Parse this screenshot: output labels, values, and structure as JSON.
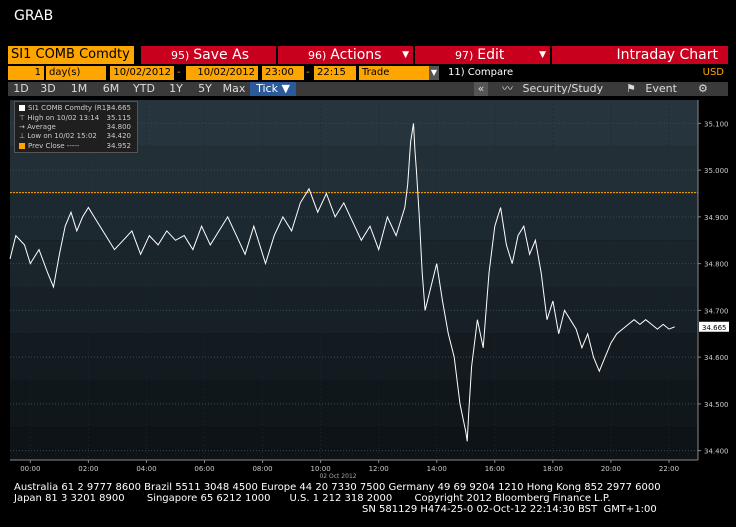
{
  "app": {
    "grab_label": "GRAB"
  },
  "header": {
    "ticker": "SI1 COMB Comdty",
    "save_as": {
      "num": "95)",
      "label": "Save As"
    },
    "actions": {
      "num": "96)",
      "label": "Actions"
    },
    "edit": {
      "num": "97)",
      "label": "Edit"
    },
    "chart_type": "Intraday Chart"
  },
  "controls": {
    "period_count": "1",
    "period_unit": "day(s)",
    "start_date": "10/02/2012",
    "end_date": "10/02/2012",
    "start_time": "23:00",
    "end_time": "22:15",
    "field": "Trade",
    "compare": "11) Compare",
    "currency": "USD"
  },
  "toolbar": {
    "buttons": [
      "1D",
      "3D",
      "1M",
      "6M",
      "YTD",
      "1Y",
      "5Y",
      "Max"
    ],
    "tick": "Tick ▼",
    "collapse": "«",
    "security_study": "Security/Study",
    "event": "Event",
    "gear": "⚙"
  },
  "legend": {
    "rows": [
      {
        "label": "SI1 COMB Comdty (R1)",
        "value": "34.665"
      },
      {
        "label": "High on 10/02 13:14",
        "value": "35.115"
      },
      {
        "label": "Average",
        "value": "34.800"
      },
      {
        "label": "Low on 10/02 15:02",
        "value": "34.420"
      },
      {
        "label": "Prev Close -----",
        "value": "34.952"
      }
    ]
  },
  "chart_data": {
    "type": "line",
    "x_ticks": [
      "00:00",
      "02:00",
      "04:00",
      "06:00",
      "08:00",
      "10:00",
      "12:00",
      "14:00",
      "16:00",
      "18:00",
      "20:00",
      "22:00"
    ],
    "x_date_label": "02 Oct 2012",
    "y_ticks": [
      "35.100",
      "35.000",
      "34.900",
      "34.800",
      "34.700",
      "34.600",
      "34.500",
      "34.400"
    ],
    "ylim": [
      34.38,
      35.15
    ],
    "xlim": [
      -0.7,
      23.0
    ],
    "prev_close": 34.952,
    "last_value": "34.665",
    "colors": {
      "line": "#ffffff",
      "prev_close": "#ffa500",
      "last_label_bg": "#ffffff"
    },
    "series": [
      {
        "x": [
          -0.7,
          -0.5,
          -0.2,
          0.0,
          0.3,
          0.6,
          0.8,
          1.0,
          1.2,
          1.4,
          1.6,
          1.8,
          2.0,
          2.3,
          2.6,
          2.9,
          3.2,
          3.5,
          3.8,
          4.1,
          4.4,
          4.7,
          5.0,
          5.3,
          5.6,
          5.9,
          6.2,
          6.5,
          6.8,
          7.1,
          7.4,
          7.7,
          7.9,
          8.1,
          8.4,
          8.7,
          9.0,
          9.3,
          9.6,
          9.9,
          10.2,
          10.5,
          10.8,
          11.1,
          11.4,
          11.7,
          12.0,
          12.3,
          12.6,
          12.9,
          13.0,
          13.1,
          13.2,
          13.25,
          13.3,
          13.4,
          13.5,
          13.6,
          13.8,
          14.0,
          14.2,
          14.4,
          14.6,
          14.8,
          15.0,
          15.05,
          15.1,
          15.2,
          15.4,
          15.6,
          15.8,
          16.0,
          16.2,
          16.4,
          16.6,
          16.8,
          17.0,
          17.2,
          17.4,
          17.6,
          17.8,
          18.0,
          18.2,
          18.4,
          18.6,
          18.8,
          19.0,
          19.2,
          19.4,
          19.6,
          19.8,
          20.0,
          20.2,
          20.4,
          20.6,
          20.8,
          21.0,
          21.2,
          21.4,
          21.6,
          21.8,
          22.0,
          22.2
        ],
        "y": [
          34.81,
          34.86,
          34.84,
          34.8,
          34.83,
          34.78,
          34.75,
          34.82,
          34.88,
          34.91,
          34.87,
          34.9,
          34.92,
          34.89,
          34.86,
          34.83,
          34.85,
          34.87,
          34.82,
          34.86,
          34.84,
          34.87,
          34.85,
          34.86,
          34.83,
          34.88,
          34.84,
          34.87,
          34.9,
          34.86,
          34.82,
          34.88,
          34.84,
          34.8,
          34.86,
          34.9,
          34.87,
          34.93,
          34.96,
          34.91,
          34.95,
          34.9,
          34.93,
          34.89,
          34.85,
          34.88,
          34.83,
          34.9,
          34.86,
          34.92,
          34.97,
          35.06,
          35.1,
          35.04,
          35.0,
          34.9,
          34.78,
          34.7,
          34.75,
          34.8,
          34.72,
          34.65,
          34.6,
          34.5,
          34.44,
          34.42,
          34.48,
          34.58,
          34.68,
          34.62,
          34.78,
          34.88,
          34.92,
          34.84,
          34.8,
          34.86,
          34.88,
          34.82,
          34.85,
          34.78,
          34.68,
          34.72,
          34.65,
          34.7,
          34.68,
          34.66,
          34.62,
          34.65,
          34.6,
          34.57,
          34.6,
          34.63,
          34.65,
          34.66,
          34.67,
          34.68,
          34.67,
          34.68,
          34.67,
          34.66,
          34.67,
          34.66,
          34.665
        ]
      }
    ]
  },
  "footer": {
    "line1": "Australia 61 2 9777 8600 Brazil 5511 3048 4500 Europe 44 20 7330 7500 Germany 49 69 9204 1210 Hong Kong 852 2977 6000",
    "line2": "Japan 81 3 3201 8900       Singapore 65 6212 1000      U.S. 1 212 318 2000       Copyright 2012 Bloomberg Finance L.P.",
    "line3": "SN 581129 H474-25-0 02-Oct-12 22:14:30 BST  GMT+1:00"
  }
}
